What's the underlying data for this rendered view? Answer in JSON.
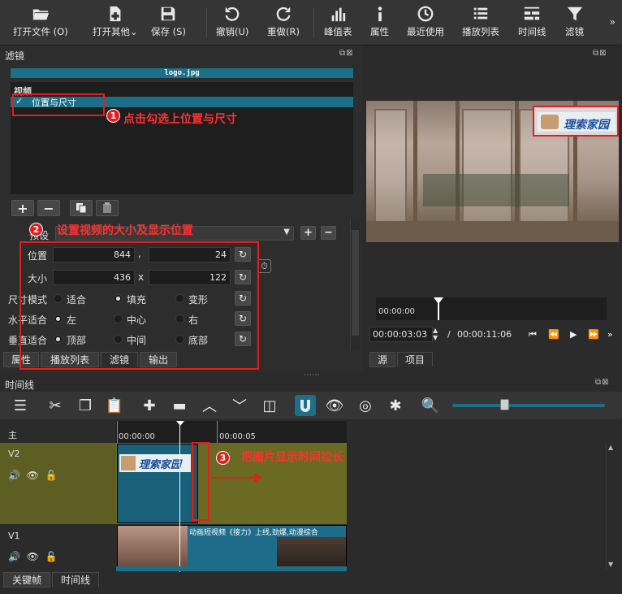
{
  "toolbar": {
    "buttons": [
      {
        "label": "打开文件 (O)",
        "icon": "folder-open-icon"
      },
      {
        "label": "打开其他",
        "icon": "file-plus-icon"
      },
      {
        "label": "保存 (S)",
        "icon": "save-icon"
      },
      {
        "label": "撤销(U)",
        "icon": "undo-icon"
      },
      {
        "label": "重做(R)",
        "icon": "redo-icon"
      },
      {
        "label": "峰值表",
        "icon": "peak-meter-icon"
      },
      {
        "label": "属性",
        "icon": "info-icon"
      },
      {
        "label": "最近使用",
        "icon": "clock-icon"
      },
      {
        "label": "播放列表",
        "icon": "list-icon"
      },
      {
        "label": "时间线",
        "icon": "timeline-icon"
      },
      {
        "label": "滤镜",
        "icon": "filter-funnel-icon"
      }
    ],
    "more": "»"
  },
  "filter_panel": {
    "title": "滤镜",
    "filename": "logo.jpg",
    "list_header": "视频",
    "list_item": {
      "check": "✓",
      "label": "位置与尺寸"
    },
    "preset_label": "预设",
    "position_label": "位置",
    "position_x": "844",
    "position_sep": ",",
    "position_y": "24",
    "size_label": "大小",
    "size_w": "436",
    "size_sep": "x",
    "size_h": "122",
    "size_mode_label": "尺寸模式",
    "size_mode_options": [
      "适合",
      "填充",
      "变形"
    ],
    "size_mode_selected": "填充",
    "h_fit_label": "水平适合",
    "h_fit_options": [
      "左",
      "中心",
      "右"
    ],
    "h_fit_selected": "左",
    "v_fit_label": "垂直适合",
    "v_fit_options": [
      "顶部",
      "中间",
      "底部"
    ],
    "v_fit_selected": "顶部",
    "tabs": [
      "属性",
      "播放列表",
      "滤镜",
      "输出"
    ],
    "active_tab": "滤镜"
  },
  "annotations": {
    "step1_num": "1",
    "step1_text": "点击勾选上位置与尺寸",
    "step2_num": "2",
    "step2_text": "设置视频的大小及显示位置",
    "step3_num": "3",
    "step3_text": "把图片显示时间拉长"
  },
  "player": {
    "logo_text": "理索家园",
    "ruler_start": "00:00:00",
    "current_time": "00:00:03:03",
    "total_sep": "/",
    "total_time": "00:00:11:06",
    "tabs": [
      "源",
      "项目"
    ]
  },
  "timeline": {
    "title": "时间线",
    "master_label": "主",
    "ruler_labels": [
      "00:00:00",
      "00:00:05"
    ],
    "tracks": [
      {
        "name": "V2"
      },
      {
        "name": "V1"
      }
    ],
    "v1_clip_title": "动画短视频《接力》上线,劲爆,动漫综合",
    "bottom_tabs": [
      "关键帧",
      "时间线"
    ]
  },
  "colors": {
    "accent": "#1b6f86",
    "annotation_red": "#e0201e",
    "track_olive": "#6b6a24"
  }
}
